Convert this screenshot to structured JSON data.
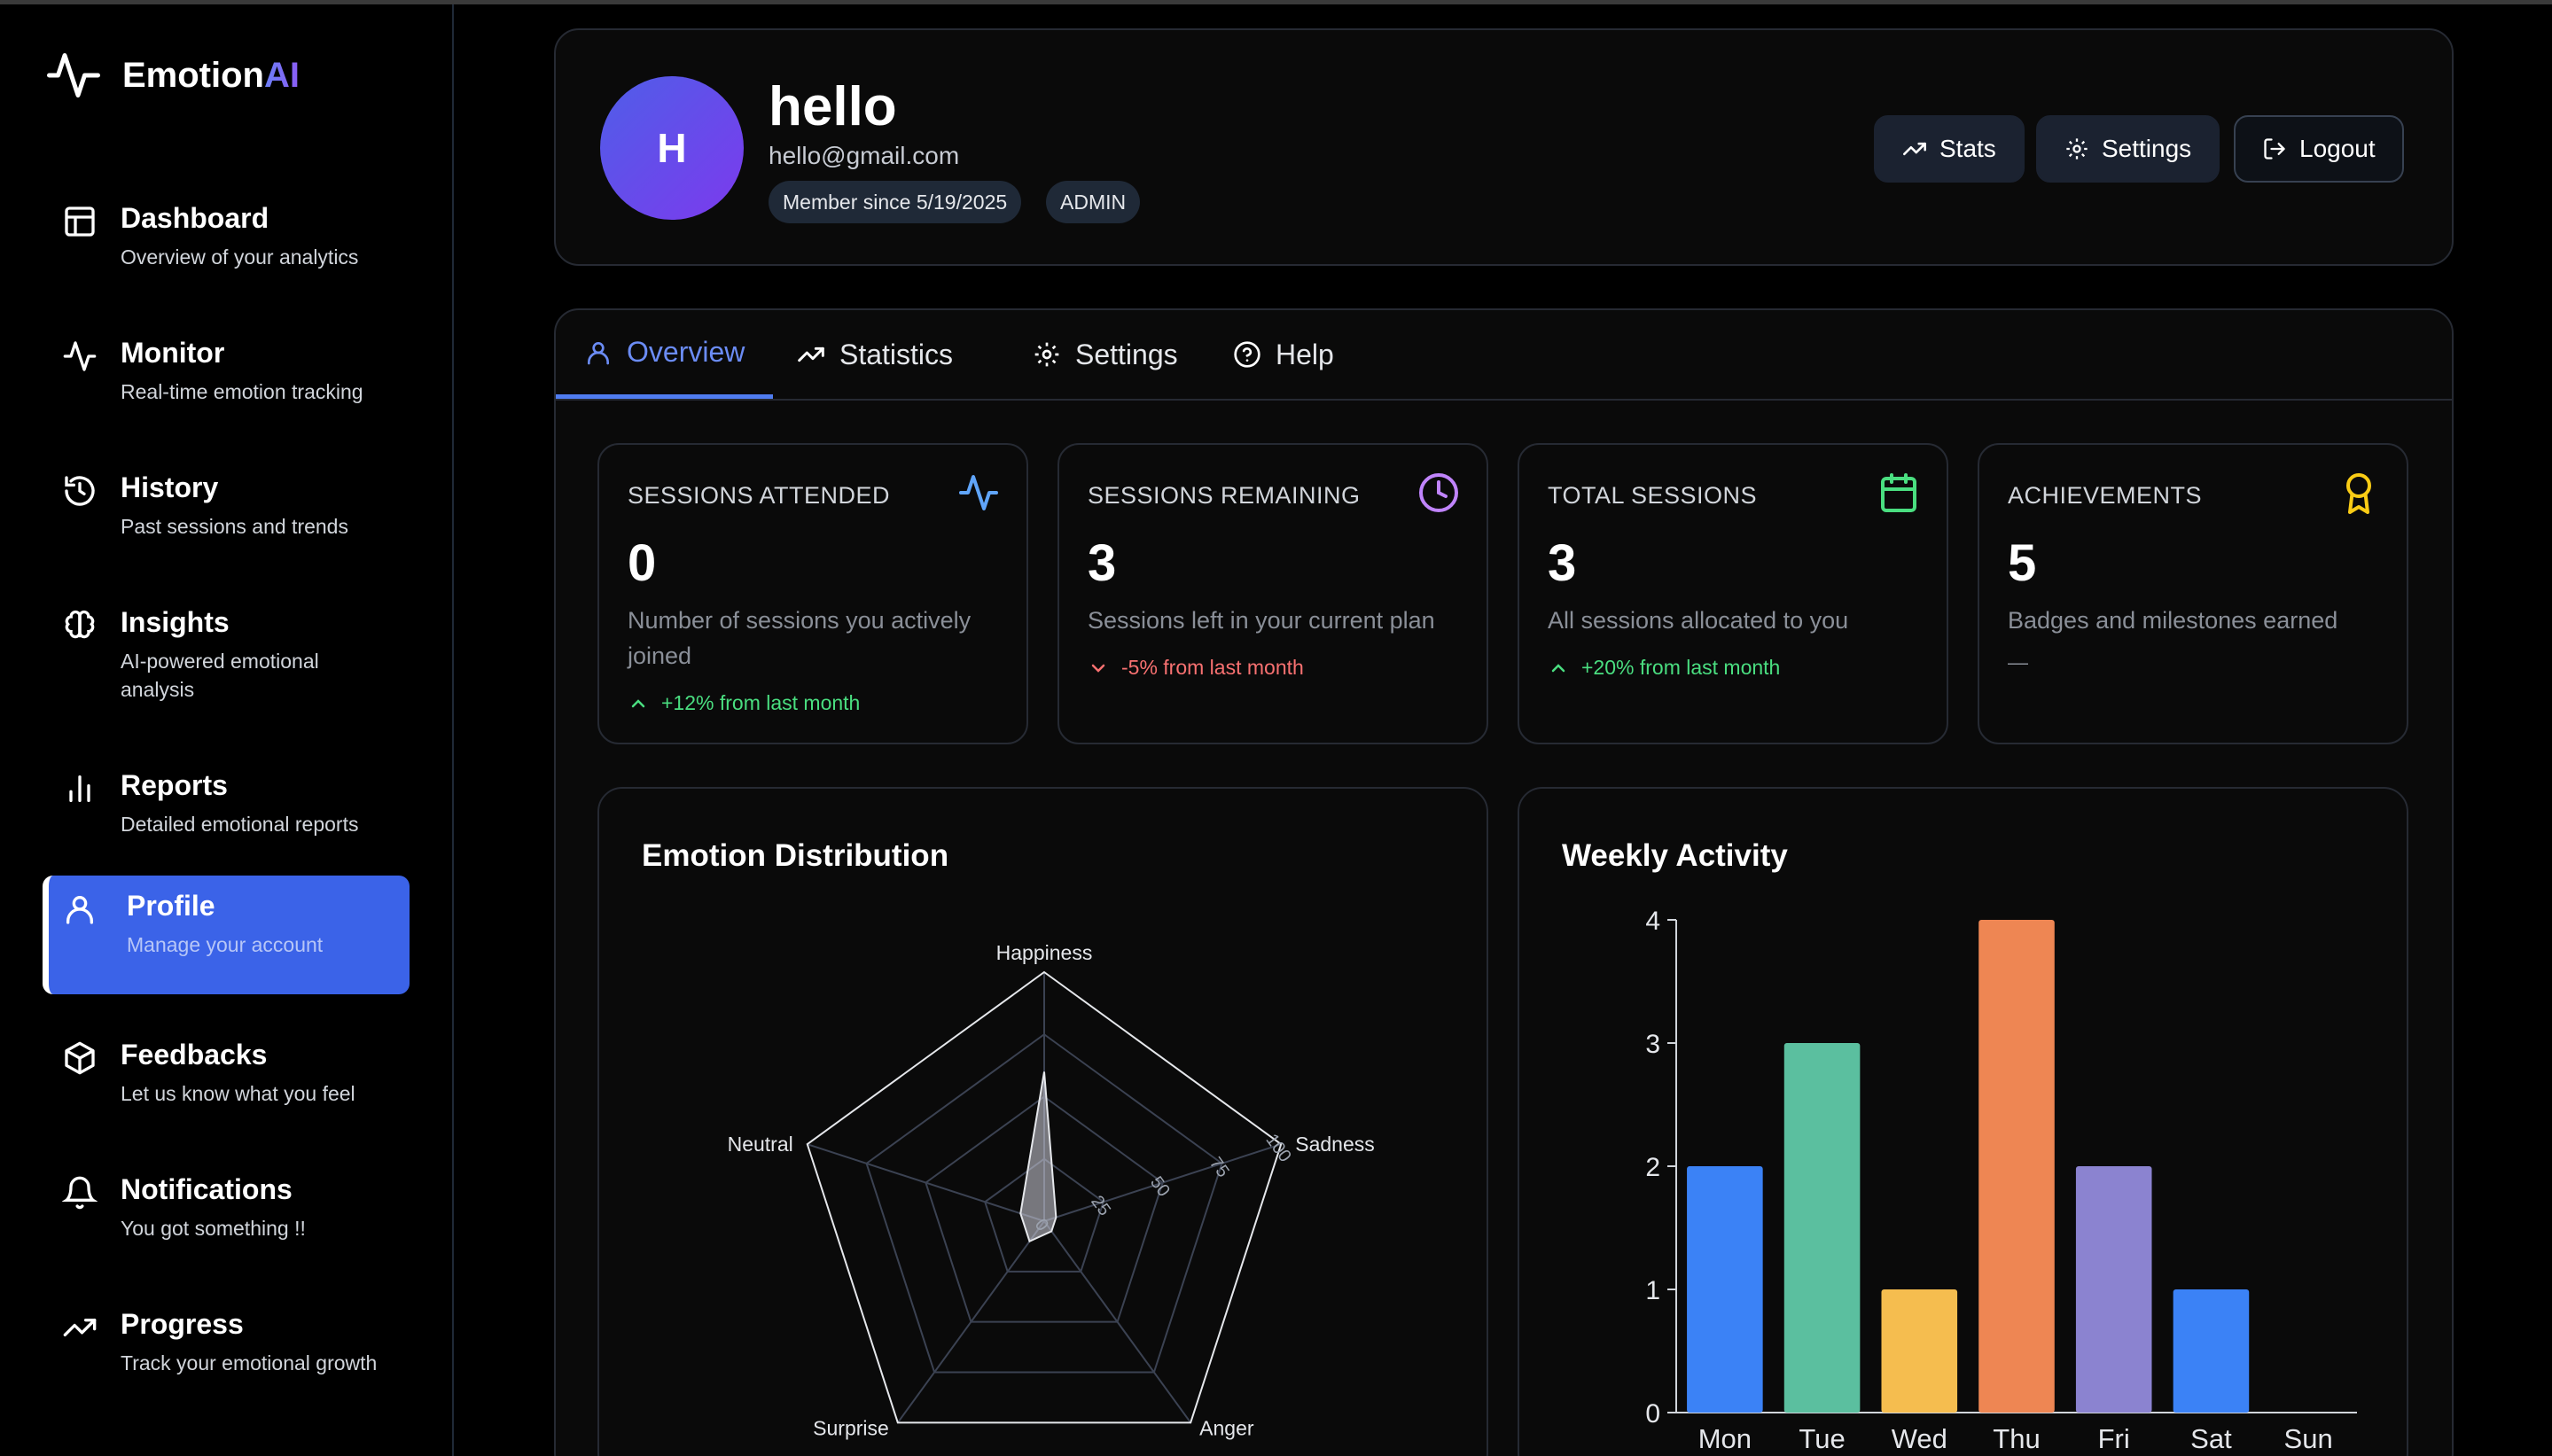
{
  "app": {
    "brand": "Emotion",
    "brand_accent": "AI"
  },
  "sidebar": {
    "items": [
      {
        "label": "Dashboard",
        "desc": "Overview of your analytics",
        "icon": "layout-icon"
      },
      {
        "label": "Monitor",
        "desc": "Real-time emotion tracking",
        "icon": "activity-icon"
      },
      {
        "label": "History",
        "desc": "Past sessions and trends",
        "icon": "history-icon"
      },
      {
        "label": "Insights",
        "desc": "AI-powered emotional analysis",
        "icon": "brain-icon"
      },
      {
        "label": "Reports",
        "desc": "Detailed emotional reports",
        "icon": "bar-chart-icon"
      },
      {
        "label": "Profile",
        "desc": "Manage your account",
        "icon": "user-icon",
        "active": true
      },
      {
        "label": "Feedbacks",
        "desc": "Let us know what you feel",
        "icon": "package-icon"
      },
      {
        "label": "Notifications",
        "desc": "You got something !!",
        "icon": "bell-icon"
      },
      {
        "label": "Progress",
        "desc": "Track your emotional growth",
        "icon": "trending-up-icon"
      }
    ]
  },
  "profile": {
    "initial": "H",
    "name": "hello",
    "email": "hello@gmail.com",
    "member_since": "Member since 5/19/2025",
    "role": "ADMIN",
    "buttons": {
      "stats": "Stats",
      "settings": "Settings",
      "logout": "Logout"
    }
  },
  "tabs": {
    "overview": "Overview",
    "statistics": "Statistics",
    "settings": "Settings",
    "help": "Help"
  },
  "stats": [
    {
      "title": "SESSIONS ATTENDED",
      "value": "0",
      "desc": "Number of sessions you actively joined",
      "trend": "+12% from last month",
      "trend_dir": "up",
      "icon": "activity-icon",
      "color": "#60a5fa"
    },
    {
      "title": "SESSIONS REMAINING",
      "value": "3",
      "desc": "Sessions left in your current plan",
      "trend": "-5% from last month",
      "trend_dir": "down",
      "icon": "clock-icon",
      "color": "#c084fc"
    },
    {
      "title": "TOTAL SESSIONS",
      "value": "3",
      "desc": "All sessions allocated to you",
      "trend": "+20% from last month",
      "trend_dir": "up",
      "icon": "calendar-icon",
      "color": "#4ade80"
    },
    {
      "title": "ACHIEVEMENTS",
      "value": "5",
      "desc": "Badges and milestones earned",
      "trend": "—",
      "trend_dir": "none",
      "icon": "award-icon",
      "color": "#facc15"
    }
  ],
  "chart_data": [
    {
      "type": "radar",
      "title": "Emotion Distribution",
      "axes": [
        "Happiness",
        "Sadness",
        "Anger",
        "Surprise",
        "Neutral"
      ],
      "values": [
        60,
        5,
        5,
        10,
        10
      ],
      "rlim": [
        0,
        100
      ],
      "ticks": [
        0,
        25,
        50,
        75,
        100
      ]
    },
    {
      "type": "bar",
      "title": "Weekly Activity",
      "categories": [
        "Mon",
        "Tue",
        "Wed",
        "Thu",
        "Fri",
        "Sat",
        "Sun"
      ],
      "values": [
        2,
        3,
        1,
        4,
        2,
        1,
        0
      ],
      "colors": [
        "#3b82f6",
        "#5bbf9f",
        "#f5bd4f",
        "#ee8653",
        "#8b83d0",
        "#3b82f6",
        "#3b82f6"
      ],
      "ylim": [
        0,
        4
      ],
      "yticks": [
        0,
        1,
        2,
        3,
        4
      ]
    }
  ]
}
